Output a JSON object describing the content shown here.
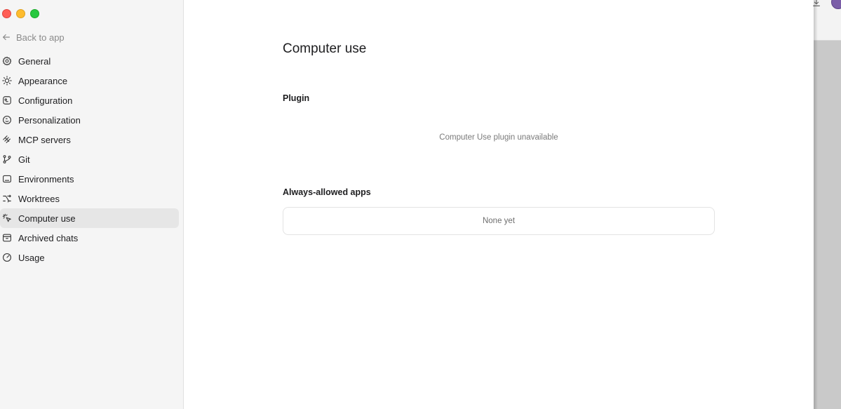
{
  "sidebar": {
    "back_label": "Back to app",
    "items": [
      {
        "label": "General",
        "icon": "gear-icon"
      },
      {
        "label": "Appearance",
        "icon": "sun-icon"
      },
      {
        "label": "Configuration",
        "icon": "sliders-icon"
      },
      {
        "label": "Personalization",
        "icon": "palette-icon"
      },
      {
        "label": "MCP servers",
        "icon": "mcp-icon"
      },
      {
        "label": "Git",
        "icon": "git-branch-icon"
      },
      {
        "label": "Environments",
        "icon": "terminal-icon"
      },
      {
        "label": "Worktrees",
        "icon": "worktree-icon"
      },
      {
        "label": "Computer use",
        "icon": "cursor-click-icon",
        "active": true
      },
      {
        "label": "Archived chats",
        "icon": "archive-icon"
      },
      {
        "label": "Usage",
        "icon": "gauge-icon"
      }
    ]
  },
  "main": {
    "title": "Computer use",
    "plugin": {
      "label": "Plugin",
      "status": "Computer Use plugin unavailable"
    },
    "always_allowed": {
      "label": "Always-allowed apps",
      "empty_text": "None yet"
    }
  },
  "colors": {
    "sidebar_bg": "#f5f5f5",
    "active_item_bg": "#e6e6e6",
    "close": "#ff5f57",
    "minimize": "#febc2e",
    "zoom": "#28c840"
  }
}
